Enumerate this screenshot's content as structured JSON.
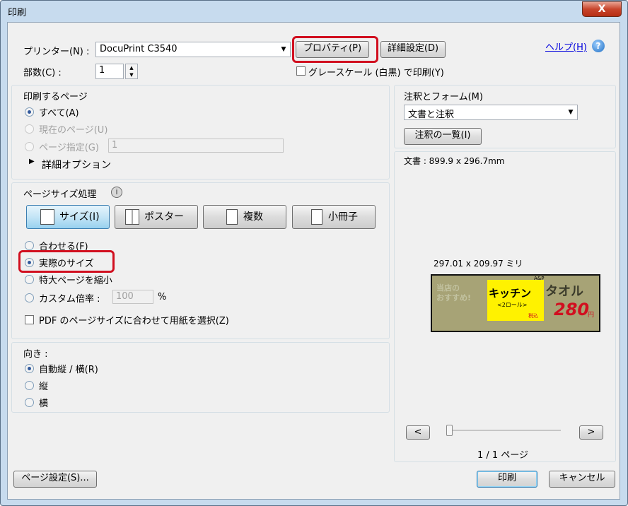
{
  "window": {
    "title": "印刷",
    "close": "X"
  },
  "printer": {
    "label": "プリンター(N) :",
    "value": "DocuPrint C3540",
    "properties": "プロパティ(P)",
    "advanced": "詳細設定(D)",
    "help": "ヘルプ(H)",
    "help_icon": "?"
  },
  "copies": {
    "label": "部数(C) :",
    "value": "1"
  },
  "grayscale": {
    "label": "グレースケール (白黒) で印刷(Y)"
  },
  "pages": {
    "heading": "印刷するページ",
    "all": "すべて(A)",
    "current": "現在のページ(U)",
    "range": "ページ指定(G)",
    "range_value": "1",
    "more": "詳細オプション"
  },
  "sizing": {
    "heading": "ページサイズ処理",
    "info_icon": "i",
    "size": "サイズ(I)",
    "poster": "ポスター",
    "multiple": "複数",
    "booklet": "小冊子",
    "fit": "合わせる(F)",
    "actual": "実際のサイズ",
    "shrink": "特大ページを縮小",
    "custom": "カスタム倍率 :",
    "custom_value": "100",
    "percent": "%",
    "pdf_paper": "PDF のページサイズに合わせて用紙を選択(Z)"
  },
  "orientation": {
    "heading": "向き :",
    "auto": "自動縦 / 横(R)",
    "portrait": "縦",
    "landscape": "横"
  },
  "comments": {
    "label": "注釈とフォーム(M)",
    "value": "文書と注釈",
    "summary": "注釈の一覧(I)"
  },
  "preview": {
    "doc_size": "文書 : 899.9 x 296.7mm",
    "paper_size": "297.01 x 209.97 ミリ",
    "prev": "<",
    "next": ">",
    "page_info": "1 / 1 ページ",
    "img_left_line1": "当店の",
    "img_left_line2": "おすすめ!",
    "img_kitchen": "キッチン",
    "img_kitchen_sub": "<2ロール>",
    "img_tax": "税込",
    "img_towel": "タオル",
    "img_price": "280",
    "img_yen": "円",
    "img_small": "A&P"
  },
  "footer": {
    "page_setup": "ページ設定(S)...",
    "print": "印刷",
    "cancel": "キャンセル"
  },
  "colors": {
    "highlight": "#d10f1f",
    "preview_bg": "#a7a376",
    "kitchen_bg": "#fff200",
    "price": "#d10f1f"
  }
}
